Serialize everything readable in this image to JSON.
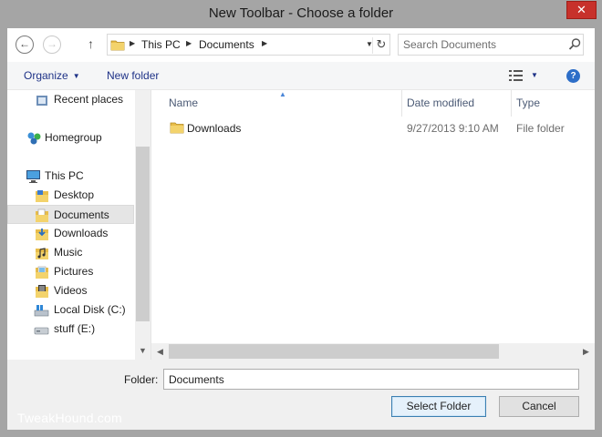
{
  "window": {
    "title": "New Toolbar - Choose a folder",
    "close_symbol": "✕"
  },
  "address": {
    "back_symbol": "←",
    "forward_symbol": "→",
    "up_symbol": "↑",
    "segments": [
      "This PC",
      "Documents"
    ],
    "refresh_symbol": "↻"
  },
  "search": {
    "placeholder": "Search Documents"
  },
  "command_bar": {
    "organize_label": "Organize",
    "new_folder_label": "New folder",
    "help_symbol": "?"
  },
  "nav_pane": {
    "items": [
      {
        "label": "Recent places",
        "icon": "recent-places-icon"
      },
      {
        "label": "Homegroup",
        "icon": "homegroup-icon"
      },
      {
        "label": "This PC",
        "icon": "computer-icon"
      },
      {
        "label": "Desktop",
        "icon": "folder-icon"
      },
      {
        "label": "Documents",
        "icon": "documents-icon",
        "selected": true
      },
      {
        "label": "Downloads",
        "icon": "downloads-icon"
      },
      {
        "label": "Music",
        "icon": "music-icon"
      },
      {
        "label": "Pictures",
        "icon": "pictures-icon"
      },
      {
        "label": "Videos",
        "icon": "videos-icon"
      },
      {
        "label": "Local Disk (C:)",
        "icon": "drive-icon"
      },
      {
        "label": "stuff (E:)",
        "icon": "removable-drive-icon"
      }
    ]
  },
  "file_list": {
    "columns": [
      "Name",
      "Date modified",
      "Type"
    ],
    "rows": [
      {
        "name": "Downloads",
        "date_modified": "9/27/2013 9:10 AM",
        "type": "File folder"
      }
    ]
  },
  "footer": {
    "folder_label": "Folder:",
    "folder_value": "Documents",
    "select_button_label": "Select Folder",
    "cancel_button_label": "Cancel"
  },
  "watermark": "TweakHound.com",
  "colors": {
    "chrome": "#a5a5a5",
    "close_button": "#c7312b",
    "link_text": "#1e3287",
    "selection": "#e5e5e5",
    "default_button_border": "#3c7fb1"
  }
}
